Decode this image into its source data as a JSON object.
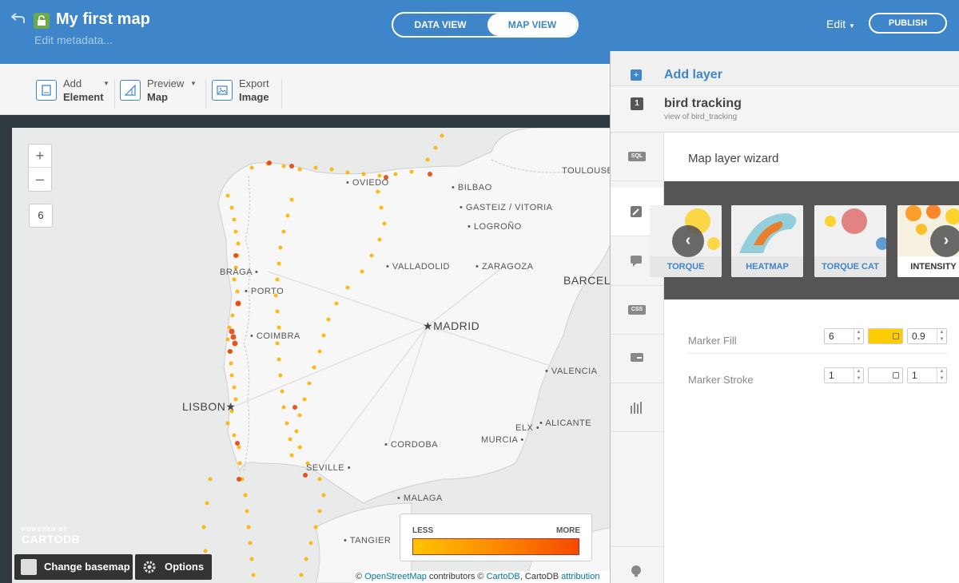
{
  "header": {
    "map_title": "My first map",
    "edit_metadata": "Edit metadata...",
    "view_tabs": [
      "DATA VIEW",
      "MAP VIEW"
    ],
    "edit_menu": "Edit",
    "publish": "PUBLISH"
  },
  "toolbar": {
    "add_element": [
      "Add",
      "Element"
    ],
    "preview_map": [
      "Preview",
      "Map"
    ],
    "export_image": [
      "Export",
      "Image"
    ]
  },
  "map": {
    "zoom_in": "+",
    "zoom_out": "–",
    "zoom_level": "6",
    "cities": {
      "toulouse": "TOULOUSE",
      "oviedo": "OVIEDO",
      "bilbao": "BILBAO",
      "gasteiz": "GASTEIZ / VITORIA",
      "logrono": "LOGROÑO",
      "braga": "BRAGA",
      "porto": "PORTO",
      "valladolid": "VALLADOLID",
      "zaragoza": "ZARAGOZA",
      "barcelona": "BARCELO",
      "madrid": "MADRID",
      "coimbra": "COIMBRA",
      "valencia": "VALENCIA",
      "lisbon": "LISBON",
      "elx": "ELX",
      "alicante": "ALICANTE",
      "cordoba": "CORDOBA",
      "murcia": "MURCIA",
      "seville": "SEVILLE",
      "malaga": "MALAGA",
      "tangier": "TANGIER"
    },
    "legend": {
      "less": "LESS",
      "more": "MORE"
    },
    "powered_by": "POWERED BY",
    "brand": "CARTODB",
    "change_basemap": "Change basemap",
    "options": "Options",
    "attribution": {
      "prefix": "©",
      "osm": "OpenStreetMap",
      "mid": "contributors ©",
      "cartodb": "CartoDB",
      "mid2": ", CartoDB",
      "attr": "attribution"
    }
  },
  "panel": {
    "add_layer": "Add layer",
    "layer_number": "1",
    "layer_name": "bird tracking",
    "layer_sub": "view of bird_tracking",
    "tabs": [
      "sql-icon",
      "wizard-icon",
      "infowindow-icon",
      "css-icon",
      "legend-icon",
      "filters-icon",
      "add-element-icon"
    ],
    "sql_tab": "SQL",
    "css_tab": "CSS",
    "wizard_title": "Map layer wizard",
    "cards": [
      "TORQUE",
      "HEATMAP",
      "TORQUE CAT",
      "INTENSITY"
    ],
    "selected_card": "INTENSITY",
    "marker_fill": {
      "label": "Marker Fill",
      "width": "6",
      "color": "#ffcc00",
      "opacity": "0.9"
    },
    "marker_stroke": {
      "label": "Marker Stroke",
      "width": "1",
      "color": "#ffffff",
      "opacity": "1"
    }
  }
}
